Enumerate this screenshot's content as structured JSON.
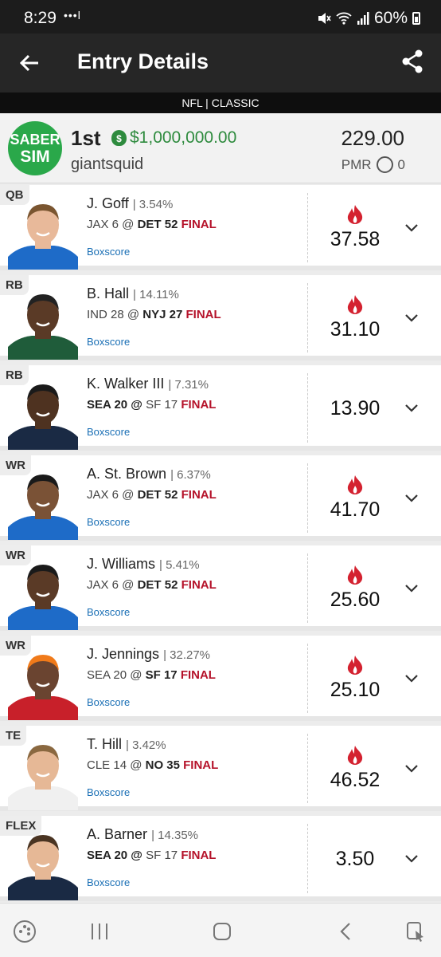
{
  "status": {
    "time": "8:29",
    "dots": "•••l",
    "battery": "60%"
  },
  "appbar": {
    "title": "Entry Details",
    "back_icon": "arrow-left-icon",
    "share_icon": "share-icon"
  },
  "contest": {
    "label": "NFL | CLASSIC"
  },
  "entry": {
    "logo_line1": "SABER",
    "logo_line2": "SIM",
    "rank": "1st",
    "prize": "$1,000,000.00",
    "username": "giantsquid",
    "score": "229.00",
    "pmr_label": "PMR",
    "pmr_value": "0"
  },
  "players": [
    {
      "pos": "QB",
      "name": "J. Goff",
      "own": "| 3.54%",
      "away": "JAX 6 @",
      "home": "DET 52",
      "status": "FINAL",
      "box": "Boxscore",
      "points": "37.58",
      "flame": true,
      "jersey": "#1e6bc8",
      "skin": "#e8b99a",
      "hair": "#7a5530"
    },
    {
      "pos": "RB",
      "name": "B. Hall",
      "own": "| 14.11%",
      "away": "IND 28 @",
      "home": "NYJ 27",
      "status": "FINAL",
      "box": "Boxscore",
      "points": "31.10",
      "flame": true,
      "jersey": "#1f5c3a",
      "skin": "#5a3a26",
      "hair": "#222222"
    },
    {
      "pos": "RB",
      "name": "K. Walker III",
      "own": "| 7.31%",
      "away": "SEA 20 @",
      "home": "SF 17",
      "status": "FINAL",
      "box": "Boxscore",
      "points": "13.90",
      "flame": false,
      "jersey": "#1a2a44",
      "skin": "#4e3220",
      "hair": "#1a1a1a"
    },
    {
      "pos": "WR",
      "name": "A. St. Brown",
      "own": "| 6.37%",
      "away": "JAX 6 @",
      "home": "DET 52",
      "status": "FINAL",
      "box": "Boxscore",
      "points": "41.70",
      "flame": true,
      "jersey": "#1e6bc8",
      "skin": "#7a5236",
      "hair": "#1a1a1a"
    },
    {
      "pos": "WR",
      "name": "J. Williams",
      "own": "| 5.41%",
      "away": "JAX 6 @",
      "home": "DET 52",
      "status": "FINAL",
      "box": "Boxscore",
      "points": "25.60",
      "flame": true,
      "jersey": "#1e6bc8",
      "skin": "#5a3a26",
      "hair": "#1a1a1a"
    },
    {
      "pos": "WR",
      "name": "J. Jennings",
      "own": "| 32.27%",
      "away": "SEA 20 @",
      "home": "SF 17",
      "status": "FINAL",
      "box": "Boxscore",
      "points": "25.10",
      "flame": true,
      "jersey": "#c8202a",
      "skin": "#6a4430",
      "hair": "#f07a1a"
    },
    {
      "pos": "TE",
      "name": "T. Hill",
      "own": "| 3.42%",
      "away": "CLE 14 @",
      "home": "NO 35",
      "status": "FINAL",
      "box": "Boxscore",
      "points": "46.52",
      "flame": true,
      "jersey": "#f0f0f0",
      "skin": "#e6b896",
      "hair": "#8a6840"
    },
    {
      "pos": "FLEX",
      "name": "A. Barner",
      "own": "| 14.35%",
      "away": "SEA 20 @",
      "home": "SF 17",
      "status": "FINAL",
      "box": "Boxscore",
      "points": "3.50",
      "flame": false,
      "jersey": "#1a2a44",
      "skin": "#e6b896",
      "hair": "#4a3422"
    }
  ],
  "players_bold": [
    "home",
    "home",
    "away",
    "home",
    "home",
    "home",
    "home",
    "away"
  ],
  "nav": {
    "icons": [
      "game-icon",
      "recent-apps-icon",
      "home-icon",
      "back-icon",
      "assistant-icon"
    ]
  }
}
